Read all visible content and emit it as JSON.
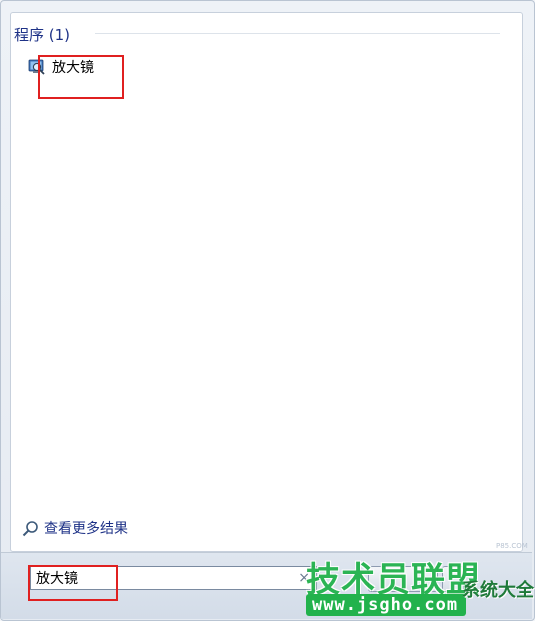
{
  "results": {
    "section_header": "程序 (1)",
    "items": [
      {
        "label": "放大镜",
        "icon": "magnifier-app-icon"
      }
    ]
  },
  "more_results": {
    "label": "查看更多结果",
    "icon": "search-icon"
  },
  "search": {
    "value": "放大镜",
    "clear_glyph": "×"
  },
  "watermark": {
    "brand": "技术员联盟",
    "url": "www.jsgho.com",
    "side": "系统大全",
    "small": "P85.COM"
  },
  "colors": {
    "header_blue": "#1e3287",
    "highlight_red": "#e02020",
    "watermark_green": "#22b24c"
  }
}
